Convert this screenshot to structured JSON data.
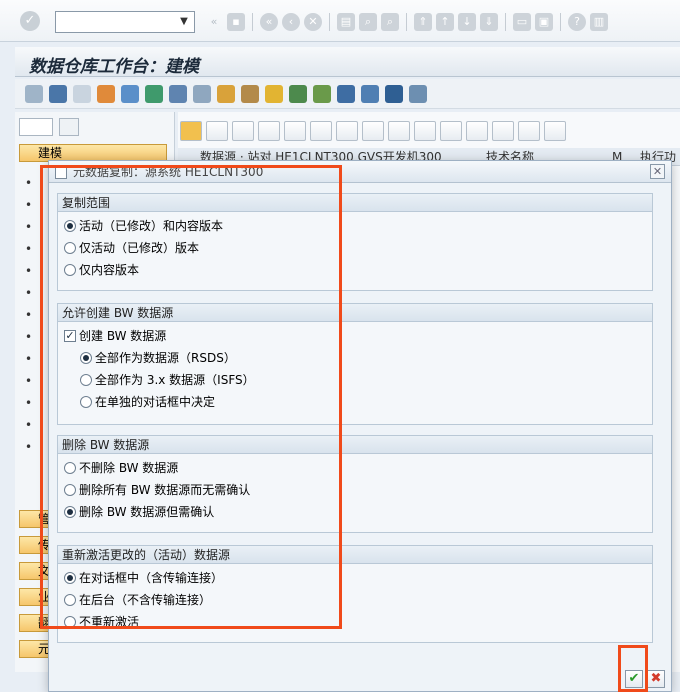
{
  "systembar": {
    "command_value": "",
    "icons": [
      "back-icon",
      "save-icon",
      "nav-first-icon",
      "nav-prev-icon",
      "nav-cancel-icon",
      "print-icon",
      "find-icon",
      "find-next-icon",
      "page-first-icon",
      "page-prev-icon",
      "page-next-icon",
      "page-last-icon",
      "new-session-icon",
      "shortcut-icon",
      "help-icon",
      "customize-icon"
    ]
  },
  "titlebar": {
    "title": "数据仓库工作台：建模"
  },
  "leftpane": {
    "tab_active": "建模",
    "bottom_tabs": [
      "管",
      "传",
      "文",
      "业",
      "翻",
      "元"
    ]
  },
  "rightpane": {
    "header_cols": [
      "数据源 · 站对 HE1CLNT300 GVS开发机300",
      "技术名称",
      "M",
      "执行功能"
    ]
  },
  "dialog": {
    "title": "元数据复制：源系统 HE1CLNT300",
    "close_label": "✕",
    "groups": [
      {
        "title": "复制范围",
        "options": [
          {
            "label": "活动（已修改）和内容版本",
            "checked": true
          },
          {
            "label": "仅活动（已修改）版本",
            "checked": false
          },
          {
            "label": "仅内容版本",
            "checked": false
          }
        ]
      },
      {
        "title": "允许创建 BW 数据源",
        "checkbox": {
          "label": "创建 BW 数据源",
          "checked": true
        },
        "options": [
          {
            "label": "全部作为数据源（RSDS）",
            "checked": true
          },
          {
            "label": "全部作为 3.x 数据源（ISFS）",
            "checked": false
          },
          {
            "label": "在单独的对话框中决定",
            "checked": false
          }
        ]
      },
      {
        "title": "删除 BW 数据源",
        "options": [
          {
            "label": "不删除 BW 数据源",
            "checked": false
          },
          {
            "label": "删除所有 BW 数据源而无需确认",
            "checked": false
          },
          {
            "label": "删除 BW 数据源但需确认",
            "checked": true
          }
        ]
      },
      {
        "title": "重新激活更改的（活动）数据源",
        "options": [
          {
            "label": "在对话框中（含传输连接）",
            "checked": true
          },
          {
            "label": "在后台（不含传输连接）",
            "checked": false
          },
          {
            "label": "不重新激活",
            "checked": false
          }
        ]
      }
    ],
    "confirm_label": "✔",
    "cancel_label": "✖"
  },
  "colors": {
    "highlight": "#f04a1a",
    "confirm": "#2a9a2a",
    "cancel": "#d43b2b"
  }
}
